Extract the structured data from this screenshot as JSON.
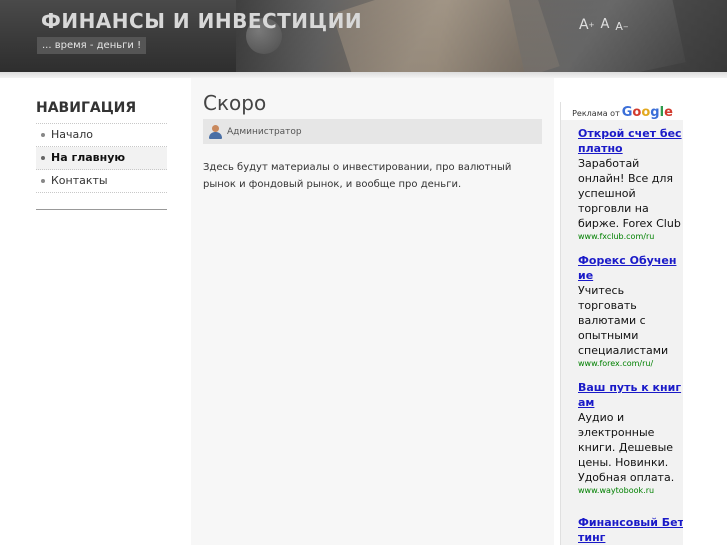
{
  "header": {
    "site_title": "ФИНАНСЫ И ИНВЕСТИЦИИ",
    "slogan": "... время - деньги !",
    "font_increase": "A",
    "font_increase_mark": "+",
    "font_normal": "A",
    "font_decrease": "A",
    "font_decrease_mark": "−"
  },
  "navigation": {
    "title": "НАВИГАЦИЯ",
    "items": [
      {
        "label": "Начало"
      },
      {
        "label": "На главную"
      },
      {
        "label": "Контакты"
      }
    ]
  },
  "article": {
    "title": "Скоро",
    "author": "Администратор",
    "body": "Здесь будут материалы о инвестировании, про валютный рынок и фондовый рынок, и вообще про деньги."
  },
  "ads": {
    "label": "Реклама от",
    "brand": {
      "G": "G",
      "o1": "o",
      "o2": "o",
      "g": "g",
      "l": "l",
      "e": "e"
    },
    "items": [
      {
        "title": "Открой счет бесплатно",
        "text": "Заработай онлайн! Все для успешной торговли на бирже. Forex Club",
        "url": "www.fxclub.com/ru"
      },
      {
        "title": "Форекс Обучение",
        "text": "Учитесь торговать валютами с опытными специалистами",
        "url": "www.forex.com/ru/"
      },
      {
        "title": "Ваш путь к книгам",
        "text": "Аудио и электронные книги. Дешевые цены. Новинки. Удобная оплата.",
        "url": "www.waytobook.ru"
      },
      {
        "title": "Финансовый Беттинг",
        "text": "",
        "url": ""
      }
    ]
  },
  "colors": {
    "header_bg": "#3a3a3a",
    "ad_link": "#1a1ac8",
    "ad_url": "#008000"
  }
}
